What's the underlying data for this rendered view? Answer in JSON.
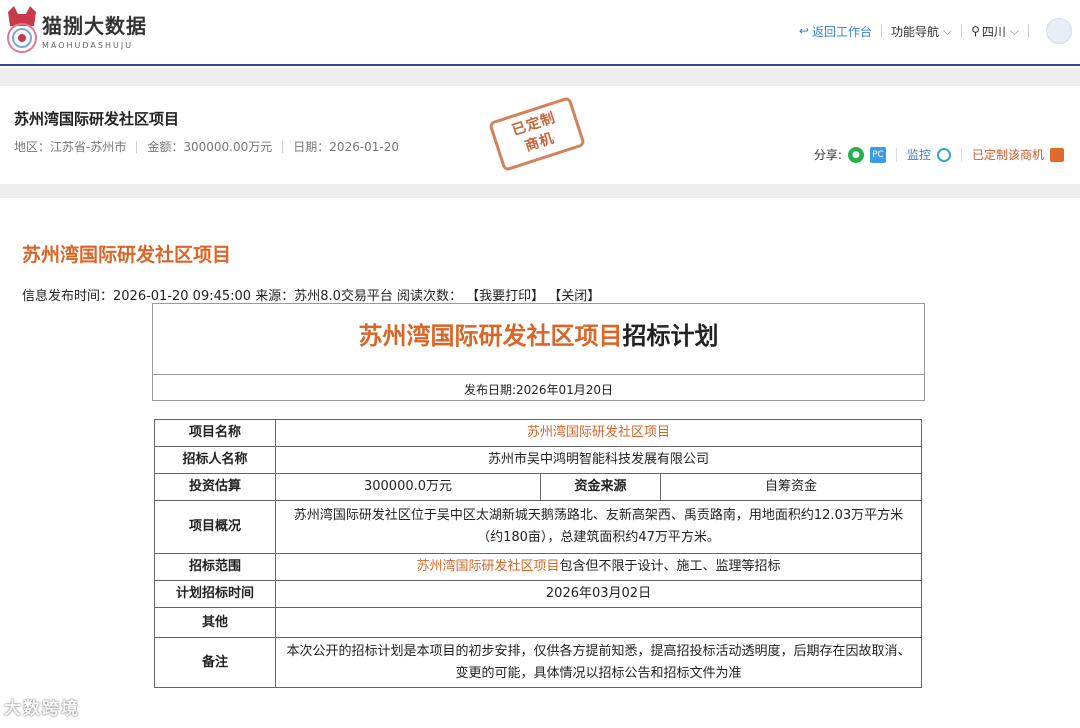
{
  "header": {
    "logo_cn": "猫捌大数据",
    "logo_en": "MAOHUDASHUJU",
    "back_label": "返回工作台",
    "nav_label": "功能导航",
    "region": "四川"
  },
  "summary": {
    "title": "苏州湾国际研发社区项目",
    "region_label": "地区：",
    "region_value": "江苏省-苏州市",
    "amount_label": "金额：",
    "amount_value": "300000.00万元",
    "date_label": "日期：",
    "date_value": "2026-01-20",
    "stamp_line1": "已定制",
    "stamp_line2": "商机",
    "share_label": "分享:",
    "pc_label": "PC",
    "monitor_label": "监控",
    "custom_label": "已定制该商机"
  },
  "article": {
    "title": "苏州湾国际研发社区项目",
    "meta": "信息发布时间：2026-01-20 09:45:00 来源：苏州8.0交易平台 阅读次数：  【我要打印】 【关闭】",
    "doc_title_hl": "苏州湾国际研发社区项目",
    "doc_title_rest": "招标计划",
    "doc_date": "发布日期:2026年01月20日"
  },
  "table": {
    "project_name_label": "项目名称",
    "project_name": "苏州湾国际研发社区项目",
    "tenderer_label": "招标人名称",
    "tenderer": "苏州市吴中鸿明智能科技发展有限公司",
    "investment_label": "投资估算",
    "investment": "300000.0万元",
    "fund_label": "资金来源",
    "fund": "自筹资金",
    "overview_label": "项目概况",
    "overview": "苏州湾国际研发社区位于吴中区太湖新城天鹅荡路北、友新高架西、禹贡路南，用地面积约12.03万平方米（约180亩），总建筑面积约47万平方米。",
    "scope_label": "招标范围",
    "scope_hl": "苏州湾国际研发社区项目",
    "scope_rest": "包含但不限于设计、施工、监理等招标",
    "plan_time_label": "计划招标时间",
    "plan_time": "2026年03月02日",
    "other_label": "其他",
    "other": "",
    "remark_label": "备注",
    "remark": "本次公开的招标计划是本项目的初步安排，仅供各方提前知悉，提高招投标活动透明度，后期存在因故取消、变更的可能，具体情况以招标公告和招标文件为准"
  },
  "watermark": "大数跨境",
  "colors": {
    "accent": "#d96628",
    "link": "#3b7fd6",
    "border": "#2f4a9c"
  }
}
